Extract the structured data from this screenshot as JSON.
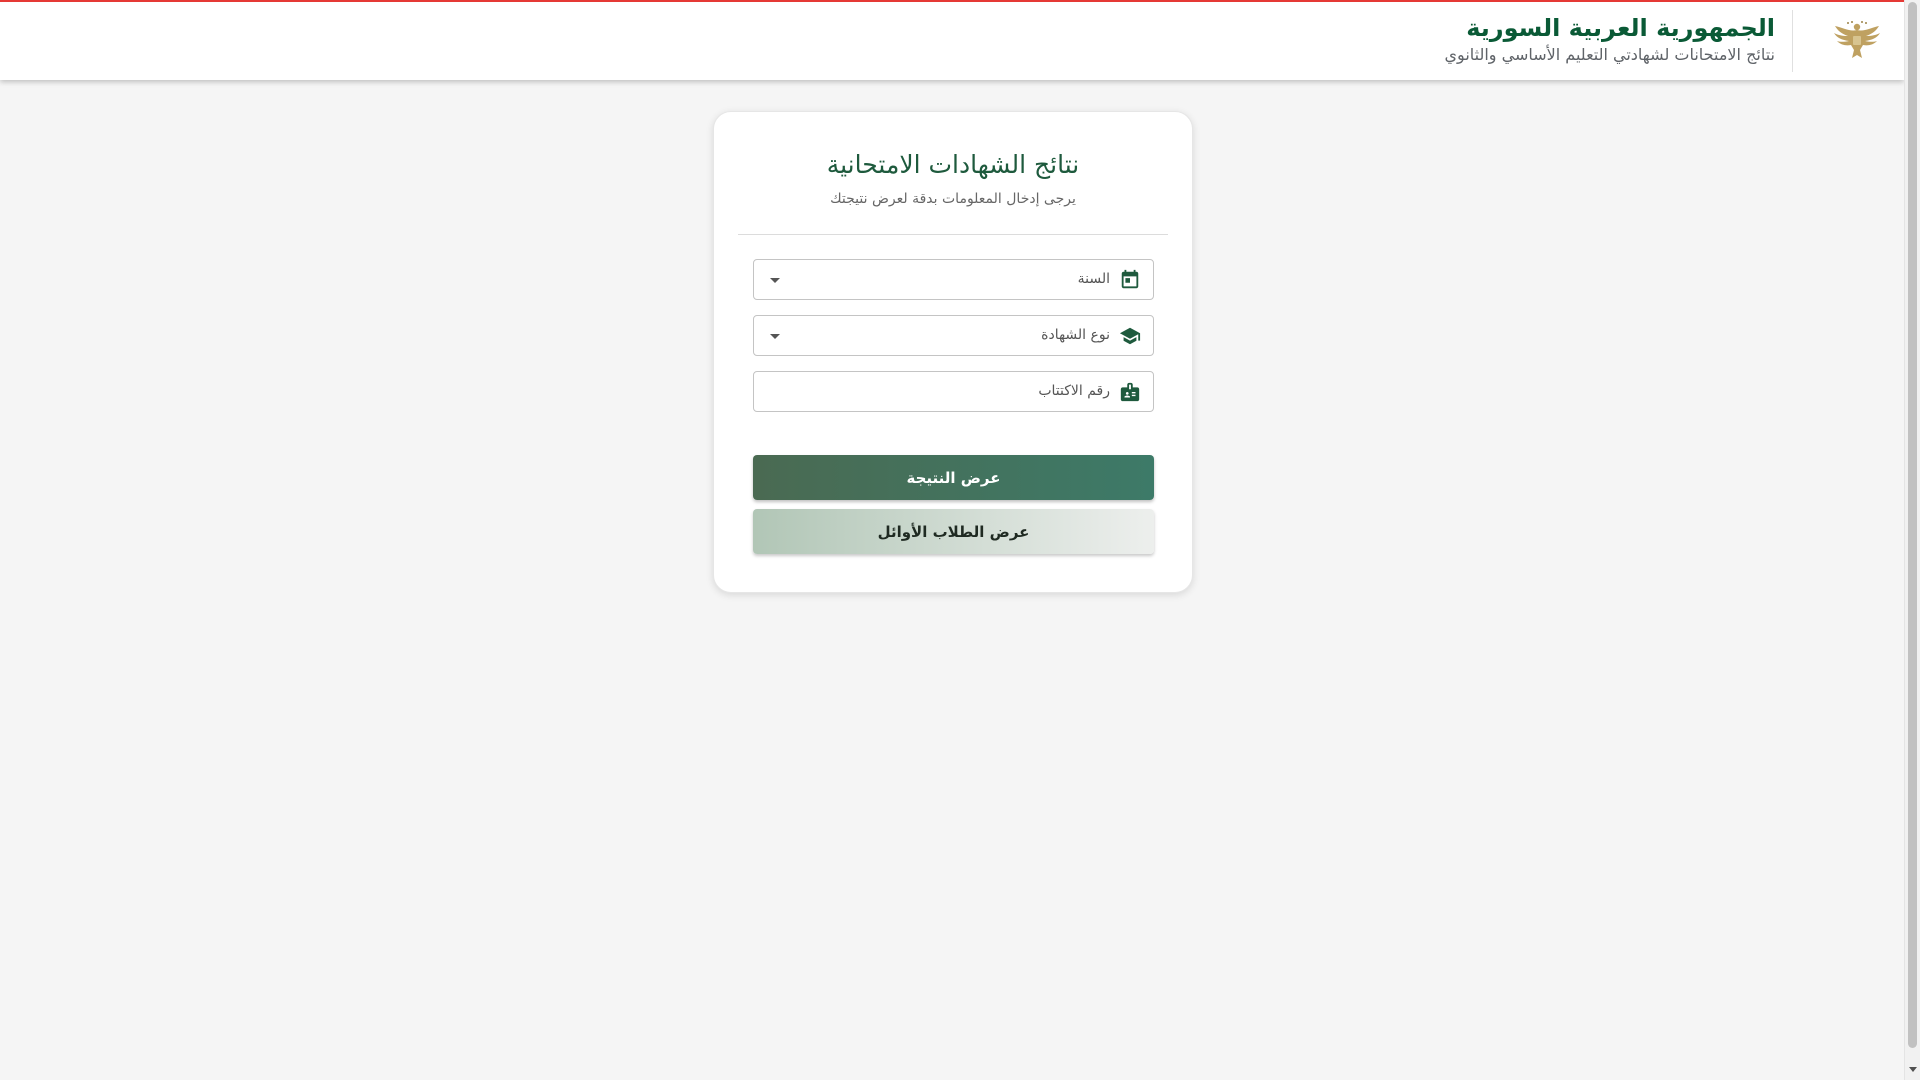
{
  "header": {
    "title": "الجمهورية العربية السورية",
    "subtitle": "نتائج الامتحانات لشهادتي التعليم الأساسي والثانوي",
    "emblem_icon": "eagle-emblem-icon",
    "accent_color": "#e53935",
    "title_color": "#0a5a36"
  },
  "card": {
    "title": "نتائج الشهادات الامتحانية",
    "subtitle": "يرجى إدخال المعلومات بدقة لعرض نتيجتك"
  },
  "form": {
    "year": {
      "label": "السنة",
      "icon": "calendar-icon"
    },
    "certificate_type": {
      "label": "نوع الشهادة",
      "icon": "graduation-cap-icon"
    },
    "subscription_number": {
      "label": "رقم الاكتتاب",
      "icon": "id-card-icon"
    }
  },
  "buttons": {
    "show_result": "عرض النتيجة",
    "top_students": "عرض الطلاب الأوائل"
  },
  "colors": {
    "primary": "#3d7a68",
    "icon": "#1e5a3d",
    "background": "#f5f5f5"
  }
}
